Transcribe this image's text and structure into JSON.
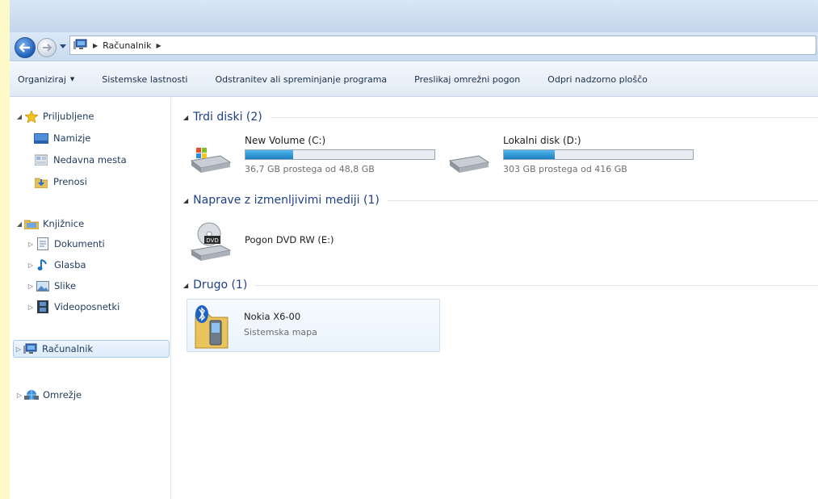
{
  "address": {
    "crumbs": [
      "Računalnik"
    ]
  },
  "toolbar": {
    "organize": "Organiziraj",
    "system_properties": "Sistemske lastnosti",
    "uninstall": "Odstranitev ali spreminjanje programa",
    "map_drive": "Preslikaj omrežni pogon",
    "control_panel": "Odpri nadzorno ploščo"
  },
  "sidebar": {
    "favorites": "Priljubljene",
    "desktop": "Namizje",
    "recent": "Nedavna mesta",
    "downloads": "Prenosi",
    "libraries": "Knjižnice",
    "documents": "Dokumenti",
    "music": "Glasba",
    "pictures": "Slike",
    "videos": "Videoposnetki",
    "computer": "Računalnik",
    "network": "Omrežje"
  },
  "groups": {
    "hard_disks": "Trdi diski (2)",
    "removable": "Naprave z izmenljivimi mediji (1)",
    "other": "Drugo (1)"
  },
  "drives": [
    {
      "name": "New Volume (C:)",
      "size": "36,7 GB prostega od 48,8 GB",
      "used_fraction": 0.25
    },
    {
      "name": "Lokalni disk (D:)",
      "size": "303 GB prostega od 416 GB",
      "used_fraction": 0.27
    }
  ],
  "dvd": {
    "name": "Pogon DVD RW (E:)",
    "badge": "DVD"
  },
  "device": {
    "name": "Nokia X6-00",
    "type": "Sistemska mapa"
  },
  "colors": {
    "accent": "#1e3f8a",
    "bar": "#1b7fc4",
    "page_bg": "#fdf9c9"
  }
}
